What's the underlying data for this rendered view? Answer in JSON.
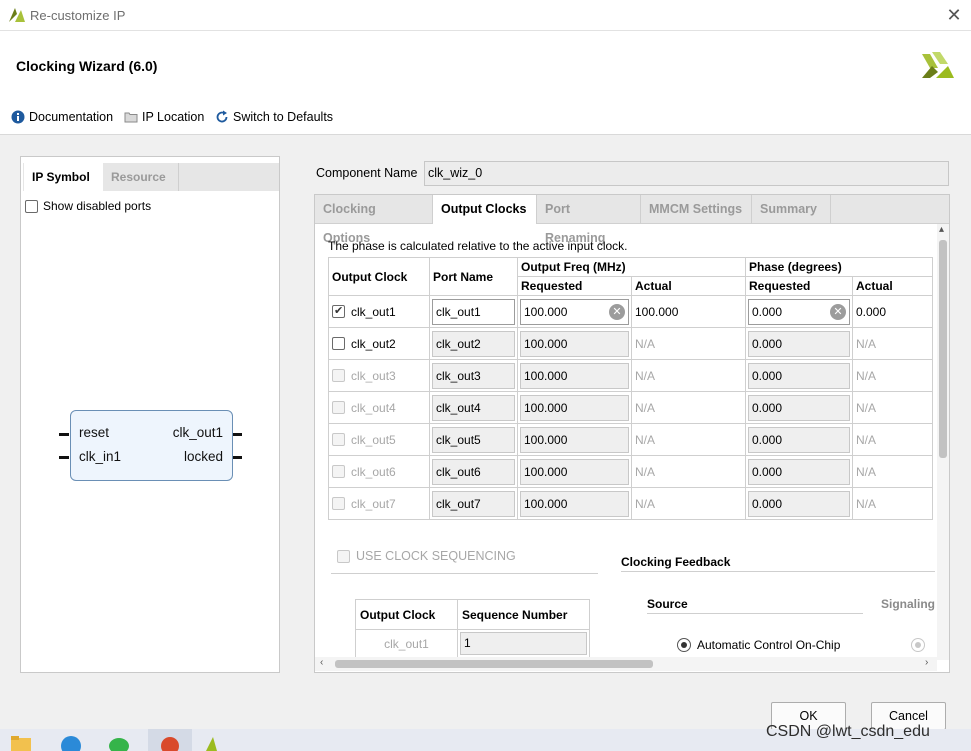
{
  "window": {
    "title": "Re-customize IP",
    "close": "✕"
  },
  "header": {
    "title": "Clocking Wizard (6.0)"
  },
  "toolbar": {
    "documentation": "Documentation",
    "ip_location": "IP Location",
    "switch_defaults": "Switch to Defaults"
  },
  "left": {
    "tabs": [
      "IP Symbol",
      "Resource"
    ],
    "show_disabled": "Show disabled ports",
    "symbol": {
      "left_pins": [
        "reset",
        "clk_in1"
      ],
      "right_pins": [
        "clk_out1",
        "locked"
      ]
    }
  },
  "component": {
    "label": "Component Name",
    "value": "clk_wiz_0"
  },
  "tabs": [
    "Clocking Options",
    "Output Clocks",
    "Port Renaming",
    "MMCM Settings",
    "Summary"
  ],
  "active_tab": "Output Clocks",
  "note": "The phase is calculated relative to the active input clock.",
  "table": {
    "headers": {
      "output_clock": "Output Clock",
      "port_name": "Port Name",
      "output_freq": "Output Freq (MHz)",
      "phase": "Phase (degrees)",
      "requested": "Requested",
      "actual": "Actual"
    },
    "rows": [
      {
        "name": "clk_out1",
        "port": "clk_out1",
        "freq_req": "100.000",
        "freq_act": "100.000",
        "phase_req": "0.000",
        "phase_act": "0.000",
        "checked": true,
        "enabled": true
      },
      {
        "name": "clk_out2",
        "port": "clk_out2",
        "freq_req": "100.000",
        "freq_act": "N/A",
        "phase_req": "0.000",
        "phase_act": "N/A",
        "checked": false,
        "enabled": true
      },
      {
        "name": "clk_out3",
        "port": "clk_out3",
        "freq_req": "100.000",
        "freq_act": "N/A",
        "phase_req": "0.000",
        "phase_act": "N/A",
        "checked": false,
        "enabled": false
      },
      {
        "name": "clk_out4",
        "port": "clk_out4",
        "freq_req": "100.000",
        "freq_act": "N/A",
        "phase_req": "0.000",
        "phase_act": "N/A",
        "checked": false,
        "enabled": false
      },
      {
        "name": "clk_out5",
        "port": "clk_out5",
        "freq_req": "100.000",
        "freq_act": "N/A",
        "phase_req": "0.000",
        "phase_act": "N/A",
        "checked": false,
        "enabled": false
      },
      {
        "name": "clk_out6",
        "port": "clk_out6",
        "freq_req": "100.000",
        "freq_act": "N/A",
        "phase_req": "0.000",
        "phase_act": "N/A",
        "checked": false,
        "enabled": false
      },
      {
        "name": "clk_out7",
        "port": "clk_out7",
        "freq_req": "100.000",
        "freq_act": "N/A",
        "phase_req": "0.000",
        "phase_act": "N/A",
        "checked": false,
        "enabled": false
      }
    ]
  },
  "sequencing": {
    "label": "USE CLOCK SEQUENCING",
    "headers": [
      "Output Clock",
      "Sequence Number"
    ],
    "rows": [
      {
        "clock": "clk_out1",
        "seq": "1"
      }
    ]
  },
  "feedback": {
    "title": "Clocking Feedback",
    "source": "Source",
    "signaling": "Signaling",
    "auto": "Automatic Control On-Chip"
  },
  "buttons": {
    "ok": "OK",
    "cancel": "Cancel"
  },
  "watermark": "CSDN @lwt_csdn_edu",
  "colors": {
    "accent": "#9bbb1f",
    "link_blue": "#1e5a9e",
    "symbol_border": "#6a8fb5"
  }
}
